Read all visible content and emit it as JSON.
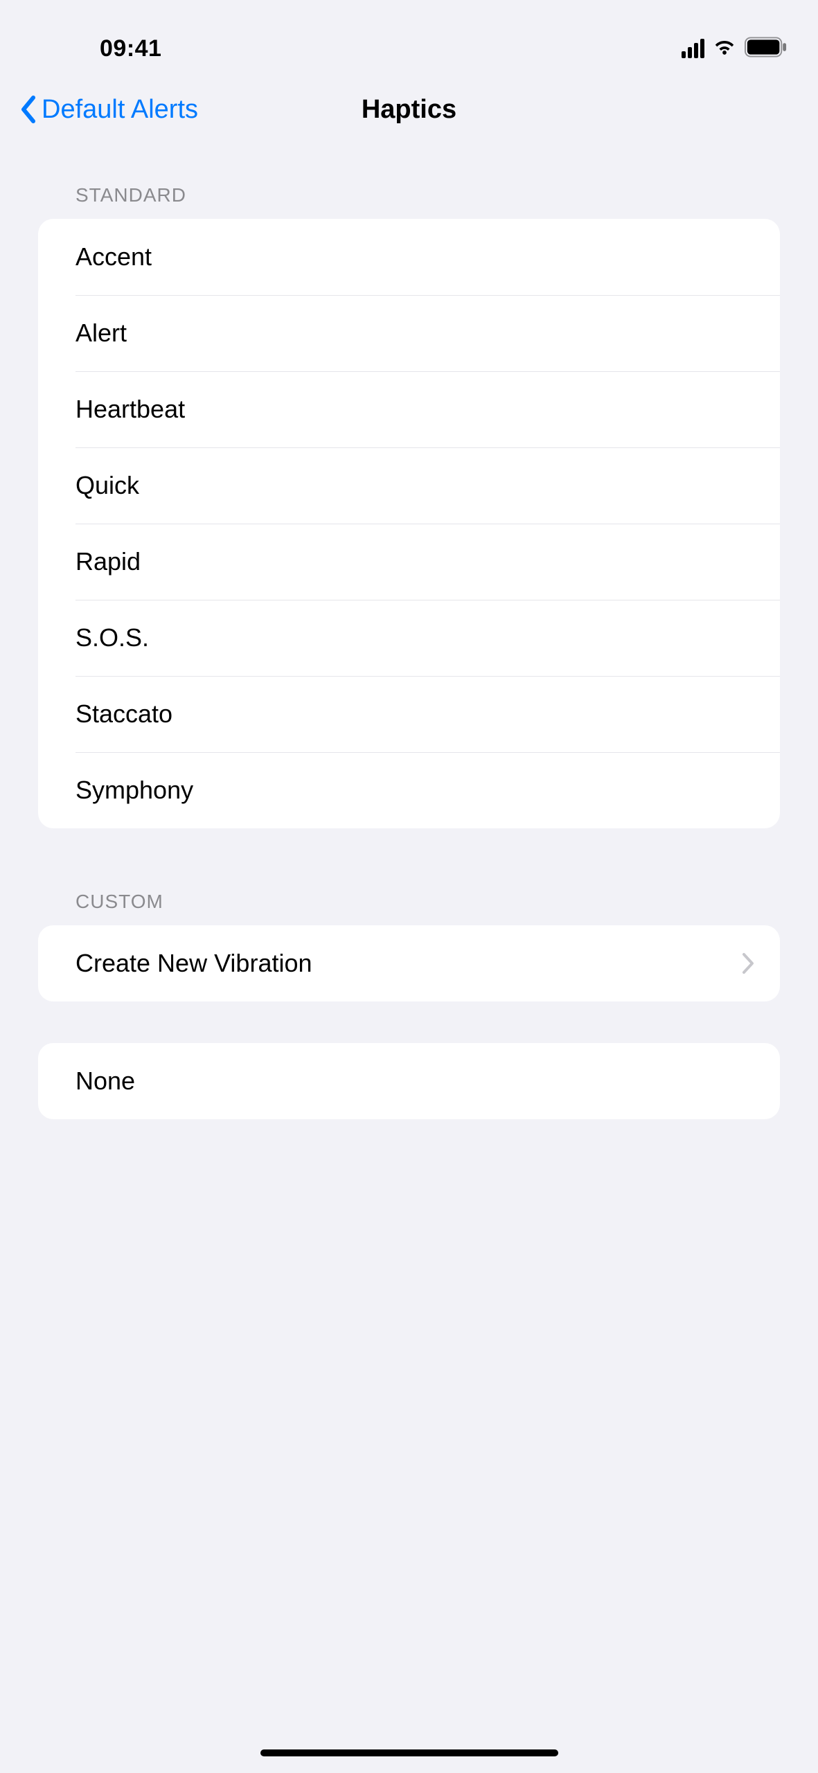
{
  "statusbar": {
    "time": "09:41"
  },
  "nav": {
    "back_label": "Default Alerts",
    "title": "Haptics"
  },
  "sections": {
    "standard": {
      "header": "STANDARD",
      "items": [
        {
          "label": "Accent"
        },
        {
          "label": "Alert"
        },
        {
          "label": "Heartbeat"
        },
        {
          "label": "Quick"
        },
        {
          "label": "Rapid"
        },
        {
          "label": "S.O.S."
        },
        {
          "label": "Staccato"
        },
        {
          "label": "Symphony"
        }
      ]
    },
    "custom": {
      "header": "CUSTOM",
      "items": [
        {
          "label": "Create New Vibration",
          "disclosure": true
        }
      ]
    },
    "none": {
      "items": [
        {
          "label": "None"
        }
      ]
    }
  }
}
